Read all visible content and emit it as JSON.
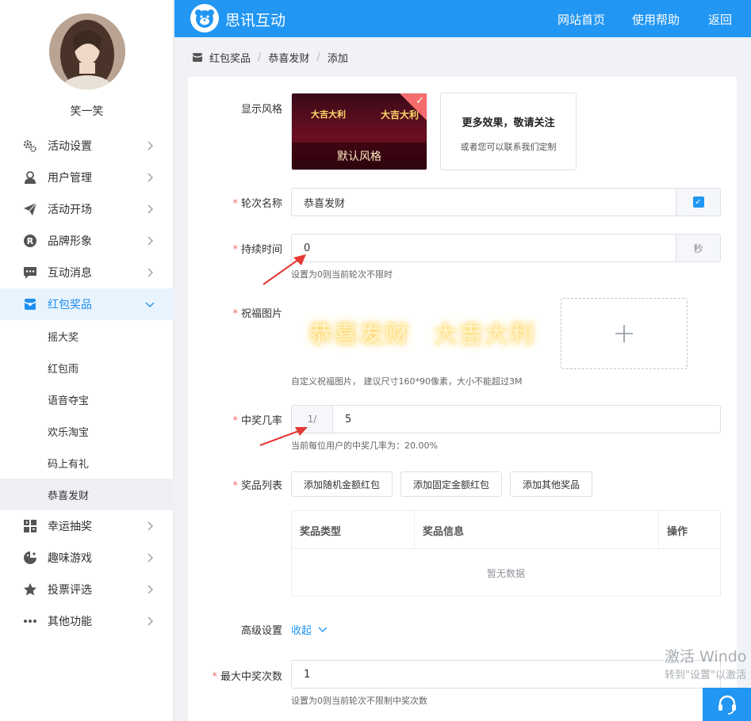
{
  "user": {
    "name": "笑一笑"
  },
  "nav": {
    "items": [
      {
        "label": "活动设置",
        "icon": "gears-icon"
      },
      {
        "label": "用户管理",
        "icon": "user-icon"
      },
      {
        "label": "活动开场",
        "icon": "paper-plane-icon"
      },
      {
        "label": "品牌形象",
        "icon": "registered-icon"
      },
      {
        "label": "互动消息",
        "icon": "chat-icon"
      },
      {
        "label": "红包奖品",
        "icon": "red-packet-icon"
      },
      {
        "label": "幸运抽奖",
        "icon": "lottery-icon"
      },
      {
        "label": "趣味游戏",
        "icon": "game-icon"
      },
      {
        "label": "投票评选",
        "icon": "star-icon"
      },
      {
        "label": "其他功能",
        "icon": "more-icon"
      }
    ],
    "sub_items": [
      "摇大奖",
      "红包雨",
      "语音夺宝",
      "欢乐淘宝",
      "码上有礼",
      "恭喜发财"
    ],
    "active_item": "红包奖品",
    "selected_sub": "恭喜发财"
  },
  "topbar": {
    "brand": "思讯互动",
    "links": [
      "网站首页",
      "使用帮助",
      "返回"
    ]
  },
  "breadcrumb": [
    "红包奖品",
    "恭喜发财",
    "添加"
  ],
  "form": {
    "style": {
      "label": "显示风格",
      "default_caption": "默认风格",
      "thumb_text_1": "大吉大利",
      "thumb_text_2": "大吉大利",
      "more_title": "更多效果，敬请关注",
      "more_sub": "或者您可以联系我们定制"
    },
    "round_name": {
      "label": "轮次名称",
      "value": "恭喜发财"
    },
    "duration": {
      "label": "持续时间",
      "value": "0",
      "unit": "秒",
      "hint": "设置为0则当前轮次不限时"
    },
    "bless_image": {
      "label": "祝福图片",
      "text_1": "恭喜发财",
      "text_2": "大吉大利",
      "hint": "自定义祝福图片， 建议尺寸160*90像素，大小不能超过3M"
    },
    "win_rate": {
      "label": "中奖几率",
      "prefix": "1/",
      "value": "5",
      "hint": "当前每位用户的中奖几率为：20.00%"
    },
    "prizes": {
      "label": "奖品列表",
      "buttons": [
        "添加随机金额红包",
        "添加固定金额红包",
        "添加其他奖品"
      ],
      "columns": [
        "奖品类型",
        "奖品信息",
        "操作"
      ],
      "empty_text": "暂无数据"
    },
    "advanced": {
      "label": "高级设置",
      "toggle": "收起"
    },
    "max_wins": {
      "label": "最大中奖次数",
      "value": "1",
      "hint": "设置为0则当前轮次不限制中奖次数"
    }
  },
  "watermark": {
    "line1": "激活 Windo",
    "line2": "转到\"设置\"以激活"
  },
  "colors": {
    "primary": "#2196f3",
    "required": "#f56c6c",
    "annotation": "#e53935"
  }
}
